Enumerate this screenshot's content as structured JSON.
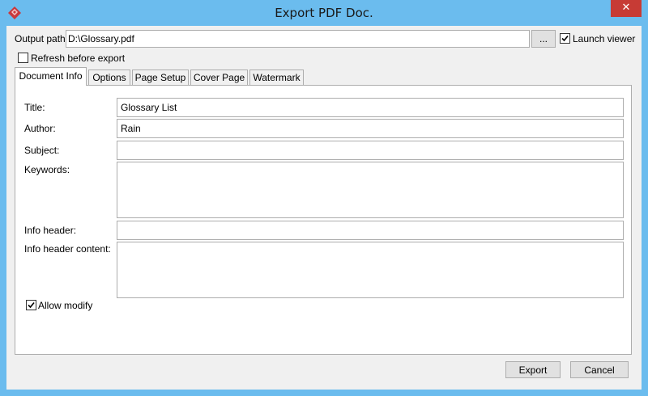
{
  "window": {
    "title": "Export PDF Doc.",
    "close_glyph": "✕"
  },
  "output": {
    "label": "Output path:",
    "value": "D:\\Glossary.pdf",
    "browse_label": "...",
    "launch_viewer_label": "Launch viewer",
    "launch_viewer_checked": true,
    "refresh_label": "Refresh before export",
    "refresh_checked": false
  },
  "tabs": [
    {
      "label": "Document Info",
      "active": true
    },
    {
      "label": "Options",
      "active": false
    },
    {
      "label": "Page Setup",
      "active": false
    },
    {
      "label": "Cover Page",
      "active": false
    },
    {
      "label": "Watermark",
      "active": false
    }
  ],
  "doc_info": {
    "title_label": "Title:",
    "title_value": "Glossary List",
    "author_label": "Author:",
    "author_value": "Rain",
    "subject_label": "Subject:",
    "subject_value": "",
    "keywords_label": "Keywords:",
    "keywords_value": "",
    "info_header_label": "Info header:",
    "info_header_value": "",
    "info_header_content_label": "Info header content:",
    "info_header_content_value": "",
    "allow_modify_label": "Allow modify",
    "allow_modify_checked": true
  },
  "footer": {
    "export_label": "Export",
    "cancel_label": "Cancel"
  },
  "colors": {
    "titlebar": "#6bbcee",
    "close_button": "#c73b35",
    "app_icon": "#c9383d"
  },
  "icons": {
    "app": "app-icon",
    "close": "close-icon",
    "check": "checkmark-icon"
  }
}
